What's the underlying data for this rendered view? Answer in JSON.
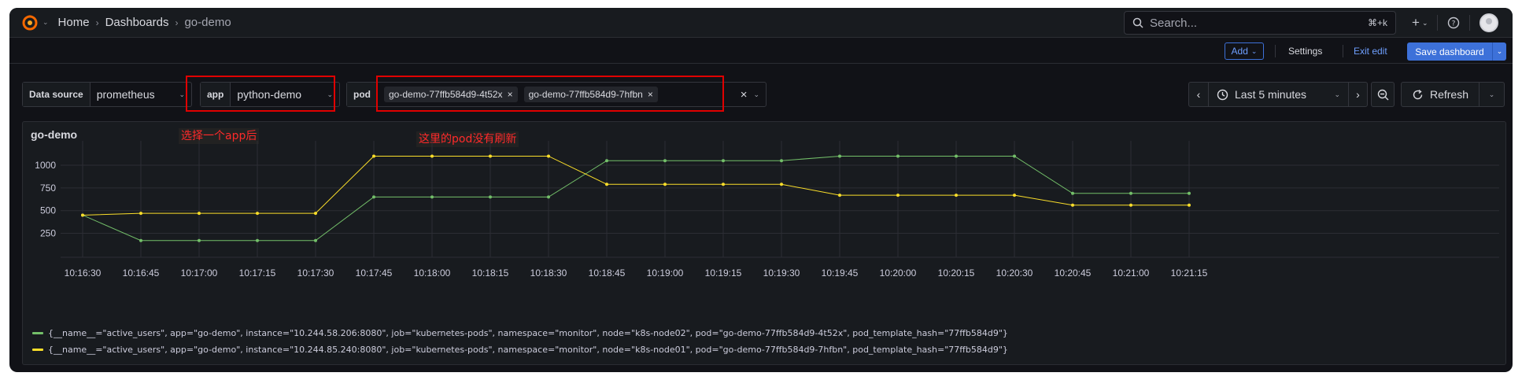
{
  "breadcrumbs": [
    "Home",
    "Dashboards",
    "go-demo"
  ],
  "search": {
    "placeholder": "Search...",
    "shortcut": "⌘+k"
  },
  "nav_icons": [
    "plus-icon",
    "help-icon",
    "avatar"
  ],
  "toolbar": {
    "add_label": "Add",
    "settings_label": "Settings",
    "exit_label": "Exit edit",
    "save_label": "Save dashboard"
  },
  "variables": {
    "datasource": {
      "label": "Data source",
      "value": "prometheus"
    },
    "app": {
      "label": "app",
      "value": "python-demo"
    },
    "pod": {
      "label": "pod",
      "chips": [
        "go-demo-77ffb584d9-4t52x",
        "go-demo-77ffb584d9-7hfbn"
      ]
    }
  },
  "time": {
    "range": "Last 5 minutes",
    "refresh": "Refresh"
  },
  "annotations": {
    "app_note": "选择一个app后",
    "pod_note": "这里的pod没有刷新"
  },
  "panel": {
    "title": "go-demo"
  },
  "colors": {
    "accent": "#3d71d9",
    "series_green": "#73bf69",
    "series_yellow": "#fade2a",
    "annotation_red": "#e00000"
  },
  "chart_data": {
    "type": "line",
    "x": [
      "10:16:30",
      "10:16:45",
      "10:17:00",
      "10:17:15",
      "10:17:30",
      "10:17:45",
      "10:18:00",
      "10:18:15",
      "10:18:30",
      "10:18:45",
      "10:19:00",
      "10:19:15",
      "10:19:30",
      "10:19:45",
      "10:20:00",
      "10:20:15",
      "10:20:30",
      "10:20:45",
      "10:21:00",
      "10:21:15"
    ],
    "yticks": [
      250,
      500,
      750,
      1000
    ],
    "ylim": [
      90,
      1130
    ],
    "series": [
      {
        "name": "{__name__=\"active_users\", app=\"go-demo\", instance=\"10.244.58.206:8080\", job=\"kubernetes-pods\", namespace=\"monitor\", node=\"k8s-node02\", pod=\"go-demo-77ffb584d9-4t52x\", pod_template_hash=\"77ffb584d9\"}",
        "color": "#73bf69",
        "values": [
          450,
          170,
          170,
          170,
          170,
          650,
          650,
          650,
          650,
          1050,
          1050,
          1050,
          1050,
          1100,
          1100,
          1100,
          1100,
          690,
          690,
          690
        ]
      },
      {
        "name": "{__name__=\"active_users\", app=\"go-demo\", instance=\"10.244.85.240:8080\", job=\"kubernetes-pods\", namespace=\"monitor\", node=\"k8s-node01\", pod=\"go-demo-77ffb584d9-7hfbn\", pod_template_hash=\"77ffb584d9\"}",
        "color": "#fade2a",
        "values": [
          450,
          470,
          470,
          470,
          470,
          1100,
          1100,
          1100,
          1100,
          790,
          790,
          790,
          790,
          670,
          670,
          670,
          670,
          560,
          560,
          560
        ]
      }
    ]
  }
}
